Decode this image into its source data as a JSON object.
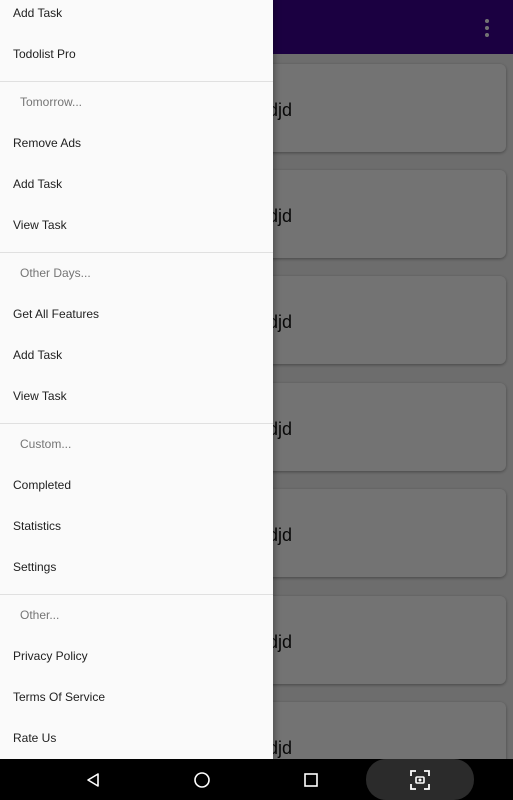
{
  "app": {
    "cards": [
      {
        "title": "djd"
      },
      {
        "title": "djd"
      },
      {
        "title": "djd"
      },
      {
        "title": "djd"
      },
      {
        "title": "djd"
      },
      {
        "title": "djd"
      },
      {
        "title": "djd"
      }
    ]
  },
  "drawer": {
    "item_add_task_top": "Add Task",
    "item_pro": "Todolist Pro",
    "section_tomorrow": "Tomorrow...",
    "item_remove_ads": "Remove Ads",
    "item_add_task_2": "Add Task",
    "item_view_task_2": "View Task",
    "section_other_days": "Other Days...",
    "item_all_features": "Get All Features",
    "item_add_task_3": "Add Task",
    "item_view_task_3": "View Task",
    "section_custom": "Custom...",
    "item_completed": "Completed",
    "item_statistics": "Statistics",
    "item_settings": "Settings",
    "section_other": "Other...",
    "item_privacy": "Privacy Policy",
    "item_terms": "Terms Of Service",
    "item_rate": "Rate Us"
  },
  "colors": {
    "toolbar": "#3c0091",
    "drawer_bg": "#fafafa",
    "scrim": "rgba(0,0,0,0.55)"
  },
  "icons": {
    "overflow": "more-vert-icon",
    "back": "back-triangle-icon",
    "home": "home-circle-icon",
    "recents": "recents-square-icon",
    "screenshot": "screenshot-icon"
  }
}
